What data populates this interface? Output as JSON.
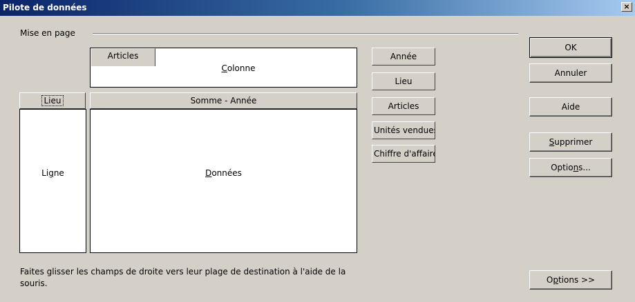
{
  "window": {
    "title": "Pilote de données",
    "close_glyph": "×"
  },
  "layout_group": {
    "label": "Mise en page"
  },
  "column_area": {
    "field": "Articles",
    "label_prefix": "",
    "label_mnemonic": "C",
    "label_rest": "olonne"
  },
  "row_area": {
    "field": "Lieu",
    "label_prefix": "Li",
    "label_mnemonic": "g",
    "label_rest": "ne"
  },
  "data_area": {
    "field": "Somme - Année",
    "label_prefix": "",
    "label_mnemonic": "D",
    "label_rest": "onnées"
  },
  "available_fields": [
    "Année",
    "Lieu",
    "Articles",
    "Unités vendues",
    "Chiffre d'affaires"
  ],
  "buttons": {
    "ok": "OK",
    "cancel": "Annuler",
    "help": "Aide",
    "delete_prefix": "",
    "delete_mnemonic": "S",
    "delete_rest": "upprimer",
    "options_prefix": "Optio",
    "options_mnemonic": "n",
    "options_rest": "s...",
    "more_prefix": "O",
    "more_mnemonic": "p",
    "more_rest": "tions >>"
  },
  "hint": "Faites glisser les champs de droite vers leur plage de destination à l'aide de la souris."
}
